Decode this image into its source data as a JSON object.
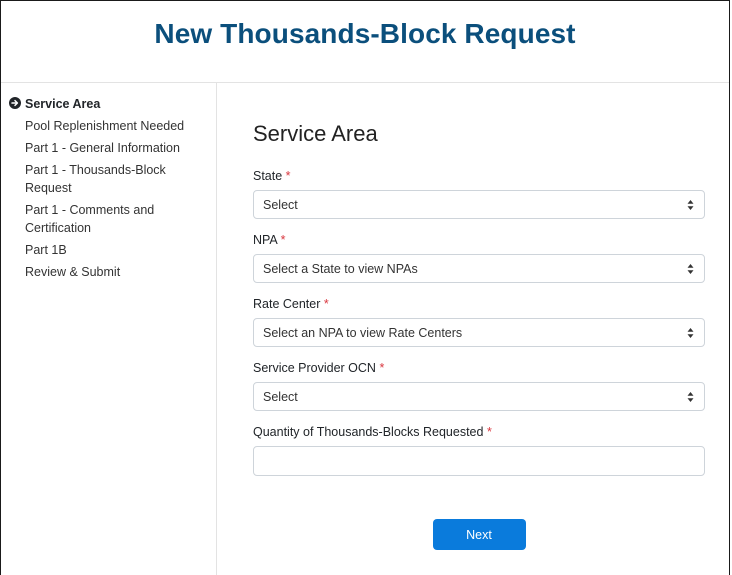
{
  "header": {
    "title": "New Thousands-Block Request"
  },
  "sidebar": {
    "items": [
      {
        "label": "Service Area",
        "active": true
      },
      {
        "label": "Pool Replenishment Needed"
      },
      {
        "label": "Part 1 - General Information"
      },
      {
        "label": "Part 1 - Thousands-Block Request"
      },
      {
        "label": "Part 1 - Comments and Certification"
      },
      {
        "label": "Part 1B"
      },
      {
        "label": "Review & Submit"
      }
    ]
  },
  "main": {
    "section_title": "Service Area",
    "required_marker": "*",
    "fields": {
      "state": {
        "label": "State",
        "value": "Select"
      },
      "npa": {
        "label": "NPA",
        "value": "Select a State to view NPAs"
      },
      "rate_center": {
        "label": "Rate Center",
        "value": "Select an NPA to view Rate Centers"
      },
      "ocn": {
        "label": "Service Provider OCN",
        "value": "Select"
      },
      "quantity": {
        "label": "Quantity of Thousands-Blocks Requested",
        "value": "",
        "placeholder": ""
      }
    },
    "next_label": "Next"
  },
  "colors": {
    "title": "#0b4f7c",
    "primary_button": "#0a7bdc",
    "required": "#d9363e"
  },
  "icons": {
    "active_nav": "arrow-circle-right-icon",
    "select_caret": "sort-caret-icon"
  }
}
